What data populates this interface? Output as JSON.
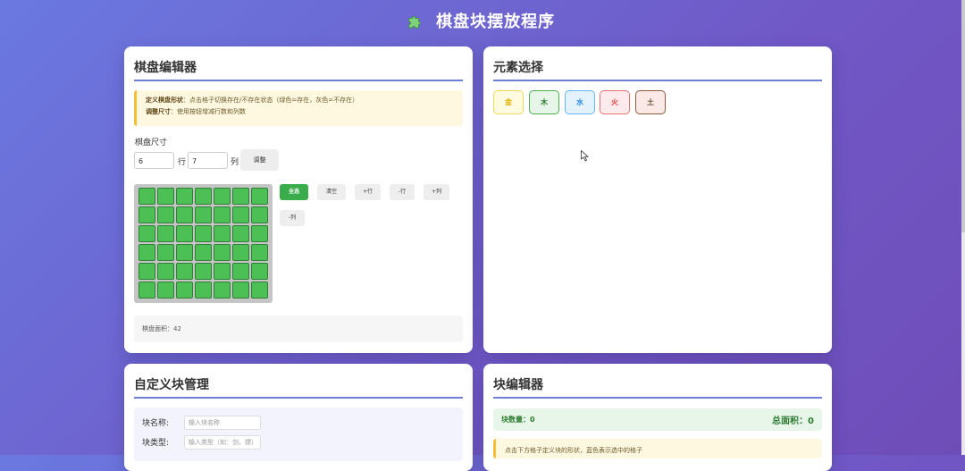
{
  "app": {
    "title": "棋盘块摆放程序",
    "icon": "puzzle-icon"
  },
  "board_editor": {
    "title": "棋盘编辑器",
    "hint": {
      "line1_strong": "定义棋盘形状",
      "line1_text": "：点击格子切换存在/不存在状态（绿色=存在，灰色=不存在）",
      "line2_strong": "调整尺寸",
      "line2_text": "：使用按钮增减行数和列数"
    },
    "size_label": "棋盘尺寸",
    "rows": "6",
    "rows_unit": "行",
    "cols": "7",
    "cols_unit": "列",
    "adjust_label": "调整",
    "actions": [
      "全选",
      "清空",
      "+行",
      "-行",
      "+列",
      "-列"
    ],
    "grid": {
      "rows": 6,
      "cols": 7,
      "state": "all-present"
    },
    "area_text": "棋盘面积：42",
    "colors": {
      "present": "#4cc055",
      "absent": "#c5c5c5",
      "accent": "#3aac4c"
    }
  },
  "element_select": {
    "title": "元素选择",
    "elements": [
      {
        "label": "金",
        "bg": "#fffbe0",
        "border": "#f1d75a",
        "color": "#e0b000"
      },
      {
        "label": "木",
        "bg": "#e8f5e9",
        "border": "#4caf50",
        "color": "#2e7d32"
      },
      {
        "label": "水",
        "bg": "#e3f2fd",
        "border": "#64b5f6",
        "color": "#1e88e5"
      },
      {
        "label": "火",
        "bg": "#ffebee",
        "border": "#e57373",
        "color": "#e53935"
      },
      {
        "label": "土",
        "bg": "#fbe9e7",
        "border": "#8d5b3a",
        "color": "#6d4c2f"
      }
    ]
  },
  "custom_blocks": {
    "title": "自定义块管理",
    "name_label": "块名称:",
    "name_placeholder": "输入块名称",
    "type_label": "块类型:",
    "type_placeholder": "输入类型（如：剑、镖）"
  },
  "block_editor": {
    "title": "块编辑器",
    "count_text": "块数量：0",
    "total_text": "总面积：0",
    "hint": "点击下方格子定义块的形状，蓝色表示选中的格子"
  }
}
